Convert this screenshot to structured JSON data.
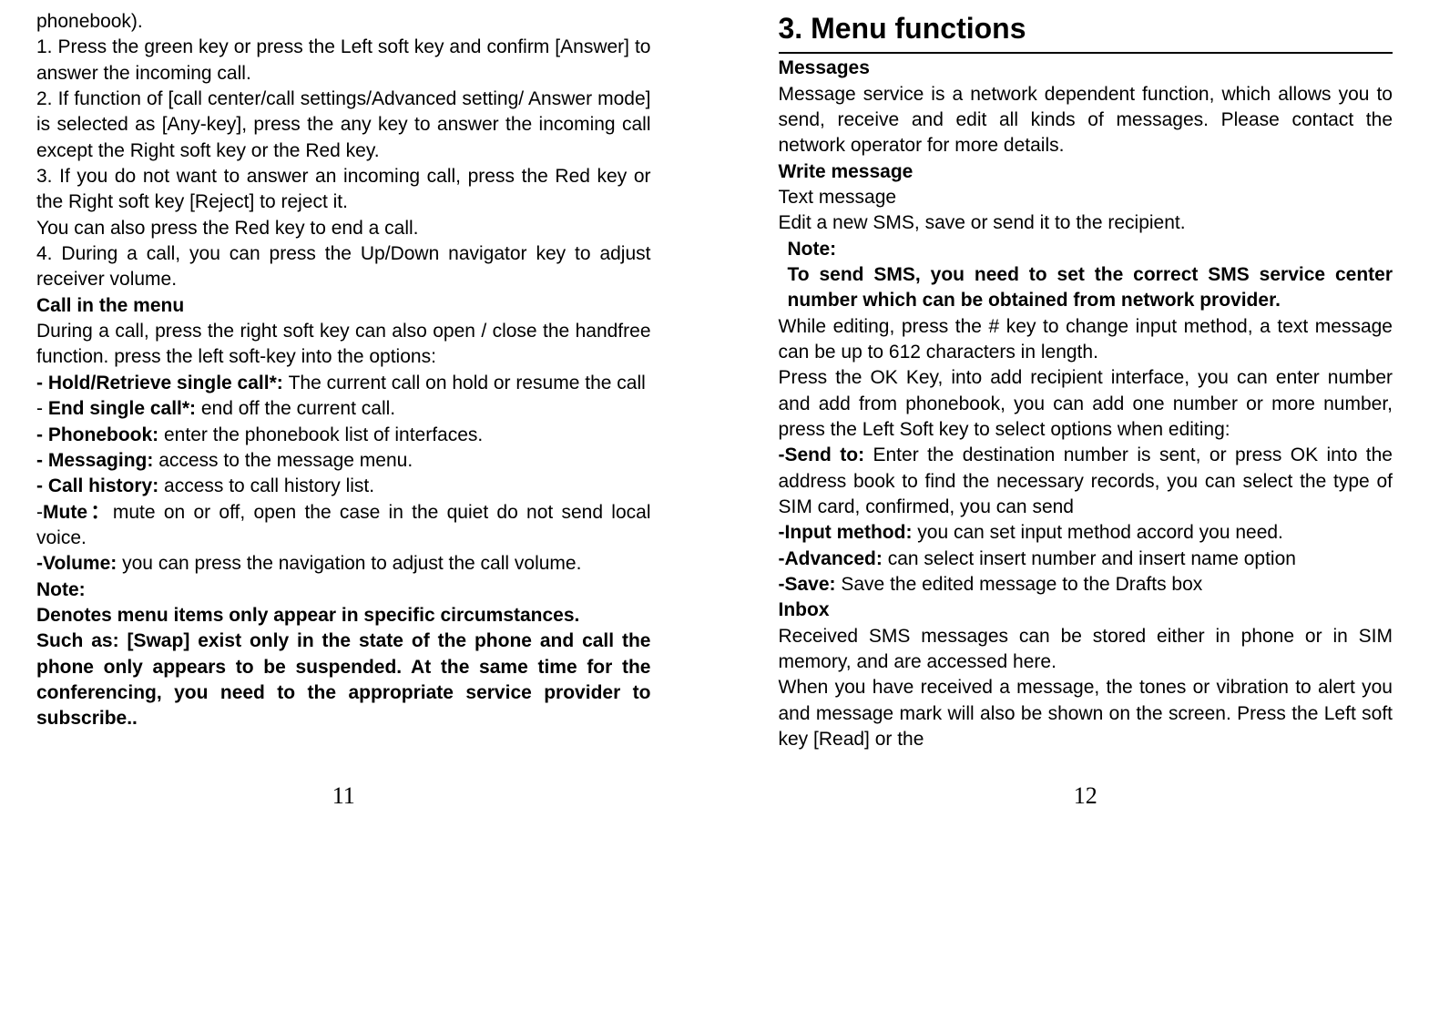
{
  "left": {
    "lines": [
      {
        "text": "phonebook).",
        "bold": false
      },
      {
        "text": "1. Press the green key or press the Left soft key and confirm [Answer] to answer the incoming call.",
        "bold": false
      },
      {
        "text": "2. If function of [call center/call settings/Advanced setting/ Answer mode] is selected as [Any-key], press the any key to answer the incoming call except the Right soft key or the Red key.",
        "bold": false
      },
      {
        "text": "3. If you do not want to answer an incoming call, press the Red key or the Right soft key [Reject] to reject it.",
        "bold": false
      },
      {
        "text": "You can also press the Red key to end a call.",
        "bold": false
      },
      {
        "text": "4. During a call, you can press the Up/Down navigator key to adjust receiver volume.",
        "bold": false
      },
      {
        "text": "Call in the menu",
        "bold": true
      },
      {
        "text": "During a call, press the right soft key can also open / close the handfree function. press the left soft-key into the options:",
        "bold": false
      },
      {
        "prefix": "- Hold/Retrieve single call*: ",
        "text": "The current call on hold or resume the call",
        "prefixBold": true
      },
      {
        "prefix": "- ",
        "prefix2": "End single call*: ",
        "text": "end off the current call.",
        "prefix2Bold": true
      },
      {
        "prefix": "- Phonebook: ",
        "text": "enter the phonebook list of interfaces.",
        "prefixBold": true
      },
      {
        "prefix": "- Messaging: ",
        "text": "access to the message menu.",
        "prefixBold": true
      },
      {
        "prefix": "- Call history: ",
        "text": "access to call history list.",
        "prefixBold": true
      },
      {
        "prefix": "-",
        "prefix2": "Mute：",
        "text": "mute on or off, open the case in the quiet do not send local voice.",
        "prefix2Bold": true
      },
      {
        "prefix": "-Volume: ",
        "text": "you can press the navigation to adjust the call volume.",
        "prefixBold": true
      },
      {
        "text": "Note:",
        "bold": true
      },
      {
        "text": "Denotes menu items only appear in specific circumstances.",
        "bold": true
      },
      {
        "text": "Such as: [Swap] exist only in the state of the phone and call the phone only appears to be suspended. At the same time for the conferencing, you need to the appropriate service provider to subscribe..",
        "bold": true
      }
    ],
    "pageNumber": "11"
  },
  "right": {
    "sectionTitle": "3.    Menu functions",
    "lines": [
      {
        "text": "Messages",
        "bold": true
      },
      {
        "text": "Message service is a network dependent function, which allows you to send, receive and edit all kinds of messages. Please contact the network operator for more details.",
        "bold": false
      },
      {
        "text": "Write message",
        "bold": true
      },
      {
        "text": "Text message",
        "bold": false
      },
      {
        "text": "Edit a new SMS, save or send it to the recipient.",
        "bold": false
      },
      {
        "text": "Note:",
        "bold": true,
        "indent": true
      },
      {
        "text": "To send SMS, you need to set the correct SMS service center number which can be obtained from network provider.",
        "bold": true,
        "indent": true
      },
      {
        "text": "While editing, press the # key to change input method, a text message can be up to 612 characters in length.",
        "bold": false
      },
      {
        "text": "Press the OK Key, into add recipient interface, you can enter number and add from phonebook, you can add one number or more number, press the Left Soft key to select options when editing:",
        "bold": false
      },
      {
        "prefix": "-Send to: ",
        "text": "Enter the destination number is sent, or press OK into the address book to find the necessary records, you can select the type of SIM card, confirmed, you can send",
        "prefixBold": true
      },
      {
        "prefix": "-Input method: ",
        "text": "you can set input method accord you need.",
        "prefixBold": true
      },
      {
        "prefix": "-Advanced: ",
        "text": "can select insert number and insert name option",
        "prefixBold": true
      },
      {
        "prefix": "-Save: ",
        "text": "Save the edited message to the Drafts box",
        "prefixBold": true
      },
      {
        "text": "Inbox",
        "bold": true
      },
      {
        "text": "Received SMS messages can be stored either in phone or in SIM memory, and are accessed here.",
        "bold": false
      },
      {
        "text": "When you have received a message, the tones or vibration to alert you and message mark will also be shown on the screen. Press the Left soft key [Read] or the",
        "bold": false
      }
    ],
    "pageNumber": "12"
  }
}
